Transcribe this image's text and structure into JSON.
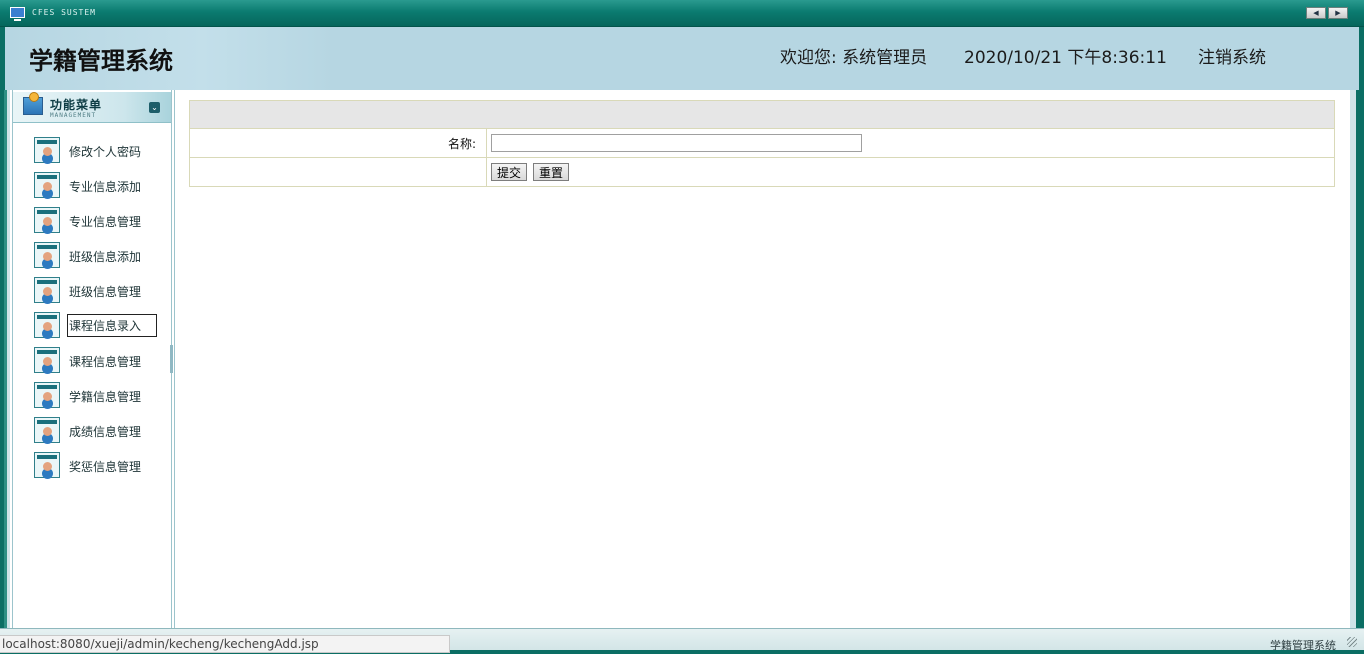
{
  "window": {
    "system_label": "CFES SUSTEM",
    "icon": "monitor-icon"
  },
  "header": {
    "app_title": "学籍管理系统",
    "welcome": "欢迎您: 系统管理员",
    "datetime": "2020/10/21 下午8:36:11",
    "logout_label": "注销系统"
  },
  "sidebar": {
    "title": "功能菜单",
    "subtitle": "MANAGEMENT",
    "items": [
      {
        "label": "修改个人密码"
      },
      {
        "label": "专业信息添加"
      },
      {
        "label": "专业信息管理"
      },
      {
        "label": "班级信息添加"
      },
      {
        "label": "班级信息管理"
      },
      {
        "label": "课程信息录入",
        "active": true
      },
      {
        "label": "课程信息管理"
      },
      {
        "label": "学籍信息管理"
      },
      {
        "label": "成绩信息管理"
      },
      {
        "label": "奖惩信息管理"
      }
    ]
  },
  "form": {
    "name_label": "名称:",
    "name_value": "",
    "submit_label": "提交",
    "reset_label": "重置"
  },
  "footer": {
    "text": "学籍管理系统",
    "status_url": "localhost:8080/xueji/admin/kecheng/kechengAdd.jsp"
  },
  "colors": {
    "frame": "#0b6e64",
    "header_bg": "#b6d6e2",
    "table_head": "#e6e6e6"
  }
}
